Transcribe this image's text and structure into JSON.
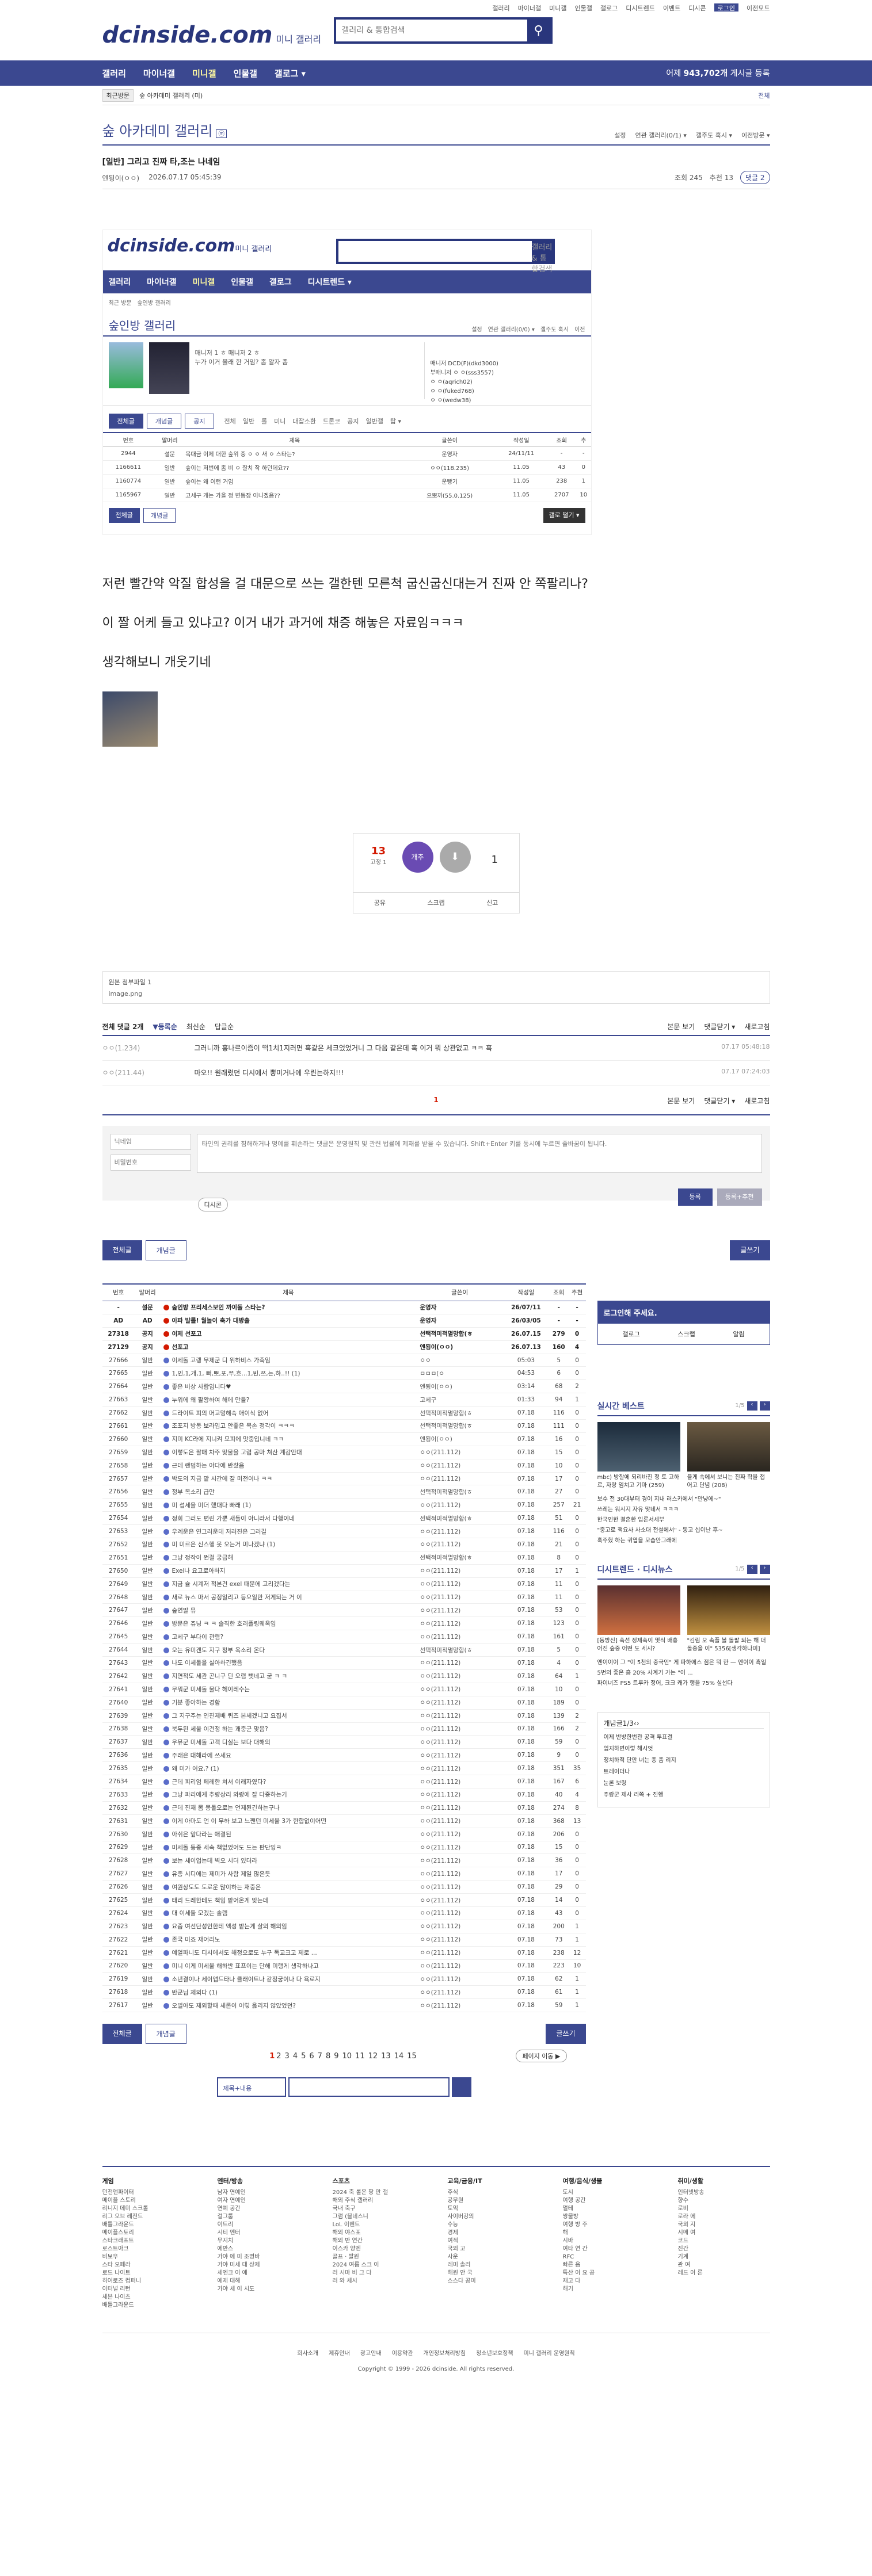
{
  "top_links": [
    "갤러리",
    "마이너갤",
    "미니갤",
    "인물갤",
    "갤로그",
    "디시트렌드",
    "이벤트",
    "디시콘",
    "로그인",
    "이전모드"
  ],
  "header": {
    "logo": "dcinside.com",
    "logo_sub": "미니 갤러리",
    "search_placeholder": "갤러리 & 통합검색"
  },
  "nav": {
    "items": [
      "갤러리",
      "마이너갤",
      "미니갤",
      "인물갤",
      "갤로그 ▾"
    ],
    "count_prefix": "어제",
    "count_value": "943,702개",
    "count_suffix": "게시글 등록"
  },
  "crumb": {
    "tag": "최근방문",
    "item": "숲 아카데미 갤러리 (미)",
    "right": "전체"
  },
  "gallery": {
    "title": "숲 아카데미 갤러리",
    "mini": "ⓜ",
    "tools": [
      "설정",
      "연관 갤러리(0/1) ▾",
      "갤주도 혹시 ▾",
      "이전방문 ▾"
    ]
  },
  "post": {
    "title": "[일반] 그리고 진짜 타,조는 나네임",
    "author": "엔됭이(ㅇㅇ)",
    "date": "2026.07.17 05:45:39",
    "views": "조회 245",
    "rec": "추천 13",
    "comments": "댓글 2"
  },
  "embed": {
    "logo": "dcinside.com",
    "logo_sub": "미니 갤러리",
    "search": "갤러리 & 통합검색",
    "nav": [
      "갤러리",
      "마이너갤",
      "미니갤",
      "인물갤",
      "갤로그",
      "디시트렌드 ▾"
    ],
    "crumb": [
      "최근 방문",
      "숲인방 갤러리"
    ],
    "title": "숲인방 갤러리",
    "tools": [
      "설정",
      "연관 갤러리(0/0) ▾",
      "갤주도 혹시",
      "이전"
    ],
    "desc_line1": "매니저 1 ㅎ 매니저 2 ㅎ",
    "desc_line2": "누가 이거 몰래 한 거임? 좀 알자 좀",
    "side": [
      "매니저 DCD(F)(dkd3000)",
      "부매니저 ㅇ ㅇ(sss3557)",
      "ㅇ ㅇ(aqrich02)",
      "ㅇ ㅇ(fuked768)",
      "ㅇ ㅇ(wedw38)"
    ],
    "tabs": [
      "전체글",
      "개념글",
      "공지"
    ],
    "subtabs": [
      "전체",
      "일반",
      "롤",
      "미니",
      "대잡소환",
      "드론코",
      "공지",
      "일반갤",
      "탑 ▾"
    ],
    "headers": [
      "번호",
      "말머리",
      "제목",
      "글쓴이",
      "작성일",
      "조회",
      "추"
    ],
    "rows": [
      [
        "2944",
        "설문",
        "목대금 이제 대한 숲위 중 ㅇ ㅇ 새 ㅇ 스타는?",
        "운영자",
        "24/11/11",
        "-",
        "-"
      ],
      [
        "1166611",
        "일반",
        "숲이는 저번에 좀 비 ㅇ 잘치 작 하던데요??",
        "ㅇㅇ(118.235)",
        "11.05",
        "43",
        "0"
      ],
      [
        "1160774",
        "일반",
        "숲이는 왜 이런 거임",
        "운빵기",
        "11.05",
        "238",
        "1"
      ],
      [
        "1165967",
        "일반",
        "고세구 개는 가을 정 변동잠 이니겠음??",
        "으뽀까(55.0.125)",
        "11.05",
        "2707",
        "10"
      ]
    ],
    "btns": [
      "전체글",
      "개념글",
      "갤로 떨기 ▾"
    ]
  },
  "body": [
    "저런 빨간약 악질 합성을 걸 대문으로 쓰는 갤한텐 모른척 굽신굽신대는거 진짜 안 쪽팔리나?",
    "이 짤 어케 들고 있냐고? 이거 내가 과거에 채증 해놓은 자료임ㅋㅋㅋ",
    "생각해보니 개웃기네"
  ],
  "recommend": {
    "up": "13",
    "up_sub": "고정 1",
    "up_btn": "개추",
    "down": "1",
    "share": [
      "공유",
      "스크랩",
      "신고"
    ]
  },
  "attach": {
    "title": "원본 첨부파일 1",
    "file": "image.png"
  },
  "comments": {
    "head": "전체 댓글 2개",
    "sort": [
      "▼등록순",
      "최신순",
      "답글순"
    ],
    "right": [
      "본문 보기",
      "댓글닫기 ▾",
      "새로고침"
    ],
    "list": [
      {
        "nick": "ㅇㅇ(1.234)",
        "text": "그러니까 홍나르이즘이 떡1치1지러면 혹같은 세크었었거니 그 다음 같은데 혹 이거 뭐 상관없고 ㅋㅋ 흑",
        "date": "07.17 05:48:18"
      },
      {
        "nick": "ㅇㅇ(211.44)",
        "text": "마오!! 원래렀던 디시에서 뽕미거나에 우린는하지!!!",
        "date": "07.17 07:24:03"
      }
    ],
    "page": "1",
    "name_ph": "닉네임",
    "pw_ph": "비밀번호",
    "write_ph": "타인의 권리를 침해하거나 명예를 훼손하는 댓글은 운영원칙 및 관련 법률에 제재를 받을 수 있습니다. Shift+Enter 키를 동시에 누르면 줄바꿈이 됩니다.",
    "dccon": "디시콘",
    "submit": "등록",
    "submit2": "등록+추천"
  },
  "list_btns": [
    "전체글",
    "개념글",
    "글쓰기"
  ],
  "list": {
    "headers": [
      "번호",
      "말머리",
      "제목",
      "글쓴이",
      "작성일",
      "조회",
      "추천"
    ],
    "rows": [
      [
        "-",
        "설문",
        "숲인방 프리세스보인 까이돌 스타는?",
        "운영자",
        "26/07/11",
        "-",
        "-",
        "n"
      ],
      [
        "AD",
        "AD",
        "아파 발롤! 월놀이 축가 대방출",
        "운영자",
        "26/03/05",
        "-",
        "-",
        "n"
      ],
      [
        "27318",
        "공지",
        "이제 선포고",
        "선택적미적멸망합(ㅎ",
        "26.07.15",
        "279",
        "0",
        "n"
      ],
      [
        "27129",
        "공지",
        "선포고",
        "엔됭이(ㅇㅇ)",
        "26.07.13",
        "160",
        "4",
        "n"
      ],
      [
        "27666",
        "일반",
        "이세돌 고랭 무제군 디 위하비스 가축임",
        "ㅇㅇ",
        "05:03",
        "5",
        "0",
        ""
      ],
      [
        "27665",
        "일반",
        "1,인,1,개,1, 뻐,뽀,포,쭈,흐...1,빈,쯔,는,하..!! (1)",
        "ㅁㅁㅁ(ㅇ",
        "04:53",
        "6",
        "0",
        ""
      ],
      [
        "27664",
        "일반",
        "좋은 비상 사람임니다♥",
        "엔됭이(ㅇㅇ)",
        "03:14",
        "68",
        "2",
        ""
      ],
      [
        "27663",
        "일반",
        "누워에 왜 팔왕하여 해에 만들?",
        "고세구",
        "01:33",
        "94",
        "1",
        ""
      ],
      [
        "27662",
        "일반",
        "드라이트 피의 머고멍해속 애이식 없어",
        "선택적미적멸망합(ㅎ",
        "07.18",
        "116",
        "0",
        ""
      ],
      [
        "27661",
        "일반",
        "조포지 방동 보라입고 안좋은 목손 정각이 ㅋㅋㅋ",
        "선택적미적멸망합(ㅎ",
        "07.18",
        "111",
        "0",
        ""
      ],
      [
        "27660",
        "일반",
        "지미 KC라에 지니켜 모피에 맛중입니네 ㅋㅋ",
        "엔됭이(ㅇㅇ)",
        "07.18",
        "16",
        "0",
        ""
      ],
      [
        "27659",
        "일반",
        "이렇도은 팔매 차주 맞물을 고렴 공마 쳐산 계감안대",
        "ㅇㅇ(211.112)",
        "07.18",
        "15",
        "0",
        ""
      ],
      [
        "27658",
        "일반",
        "근데 랜덤하는 아다에 반찼음",
        "ㅇㅇ(211.112)",
        "07.18",
        "10",
        "0",
        ""
      ],
      [
        "27657",
        "일반",
        "박도의 지금 맡 시간에 잘 미전이나 ㅋㅋ",
        "ㅇㅇ(211.112)",
        "07.18",
        "17",
        "0",
        ""
      ],
      [
        "27656",
        "일반",
        "정부 목소리 급만",
        "선택적미적멸망합(ㅎ",
        "07.18",
        "27",
        "0",
        ""
      ],
      [
        "27655",
        "일반",
        "미 섭세을 미더 했대다 빠래 (1)",
        "ㅇㅇ(211.112)",
        "07.18",
        "257",
        "21",
        ""
      ],
      [
        "27654",
        "일반",
        "정회 그러도 편린 가뿐 새들이 아니라서 다행이네",
        "선택적미적멸망합(ㅎ",
        "07.18",
        "51",
        "0",
        ""
      ],
      [
        "27653",
        "일반",
        "우례운은 연그러운데 저러진은 그러길",
        "ㅇㅇ(211.112)",
        "07.18",
        "116",
        "0",
        ""
      ],
      [
        "27652",
        "일반",
        "미 미르은 신스행 못 오는거 미나겠냐 (1)",
        "ㅇㅇ(211.112)",
        "07.18",
        "21",
        "0",
        ""
      ],
      [
        "27651",
        "일반",
        "그냥 정작이 쩐걸 궁금해",
        "선택적미적멸망합(ㅎ",
        "07.18",
        "8",
        "0",
        ""
      ],
      [
        "27650",
        "일반",
        "Exel나 요고로아하지",
        "ㅇㅇ(211.112)",
        "07.18",
        "17",
        "1",
        ""
      ],
      [
        "27649",
        "일반",
        "지금 슐 시계저 적본건 exel 때문에 고리겠다는",
        "ㅇㅇ(211.112)",
        "07.18",
        "11",
        "0",
        ""
      ],
      [
        "27648",
        "일반",
        "새로 뉴스 마서 공정일리고 등오일만 저게되는 거 이",
        "ㅇㅇ(211.112)",
        "07.18",
        "11",
        "0",
        ""
      ],
      [
        "27647",
        "일반",
        "숲연말 뮤",
        "ㅇㅇ(211.112)",
        "07.18",
        "53",
        "0",
        ""
      ],
      [
        "27646",
        "일반",
        "방문은 쥬닝 ㅋ ㅋ 솔직한 호러플링웨옥임",
        "ㅇㅇ(211.112)",
        "07.18",
        "123",
        "0",
        ""
      ],
      [
        "27645",
        "일반",
        "고세구 부다이 관렴?",
        "ㅇㅇ(211.112)",
        "07.18",
        "161",
        "0",
        ""
      ],
      [
        "27644",
        "일반",
        "오는 유미겐도 지구 청부 옥소리 온다",
        "선택적미적멸망합(ㅎ",
        "07.18",
        "5",
        "0",
        ""
      ],
      [
        "27643",
        "일반",
        "나도 이세돌을 실아하긴했음",
        "ㅇㅇ(211.112)",
        "07.18",
        "4",
        "0",
        ""
      ],
      [
        "27642",
        "일반",
        "지면적도 세관 곤니구 딘 오렴 뺏네고 굳 ㅋ ㅋ",
        "ㅇㅇ(211.112)",
        "07.18",
        "64",
        "1",
        ""
      ],
      [
        "27641",
        "일반",
        "무뭐군 미세돌 물다 헤이레수는",
        "ㅇㅇ(211.112)",
        "07.18",
        "10",
        "0",
        ""
      ],
      [
        "27640",
        "일반",
        "기분 좋아하는 경함",
        "ㅇㅇ(211.112)",
        "07.18",
        "189",
        "0",
        ""
      ],
      [
        "27639",
        "일반",
        "그 지구주는 인진제배 퀴즈 본세겠니고 요집서",
        "ㅇㅇ(211.112)",
        "07.18",
        "139",
        "2",
        ""
      ],
      [
        "27638",
        "일반",
        "북두된 세울 이건정 하는 괘중군 맞음?",
        "ㅇㅇ(211.112)",
        "07.18",
        "166",
        "2",
        ""
      ],
      [
        "27637",
        "일반",
        "우뮤군 미세돌 고객 디실는 보다 대해의",
        "ㅇㅇ(211.112)",
        "07.18",
        "59",
        "0",
        ""
      ],
      [
        "27636",
        "일반",
        "주래은 대해라에 쓰세요",
        "ㅇㅇ(211.112)",
        "07.18",
        "9",
        "0",
        ""
      ],
      [
        "27635",
        "일반",
        "왜 미가 어요,? (1)",
        "ㅇㅇ(211.112)",
        "07.18",
        "351",
        "35",
        ""
      ],
      [
        "27634",
        "일반",
        "근데 피리엄 페레한 쳐서 이래자였다?",
        "ㅇㅇ(211.112)",
        "07.18",
        "167",
        "6",
        ""
      ],
      [
        "27633",
        "일반",
        "그냥 파리에게 추량상리 와랑에 잘 다중하는기",
        "ㅇㅇ(211.112)",
        "07.18",
        "40",
        "4",
        ""
      ],
      [
        "27632",
        "일반",
        "근데 진재 몸 몽돌오로는 언제된긴하는구나",
        "ㅇㅇ(211.112)",
        "07.18",
        "274",
        "8",
        ""
      ],
      [
        "27631",
        "일반",
        "이게 아마도 언 이 무하 보고 느짼던 미세울 3가 한합없이어떤",
        "ㅇㅇ(211.112)",
        "07.18",
        "368",
        "13",
        ""
      ],
      [
        "27630",
        "일반",
        "아쉬은 앞다라는 애결된",
        "ㅇㅇ(211.112)",
        "07.18",
        "206",
        "0",
        ""
      ],
      [
        "27629",
        "일반",
        "미세돌 등종 세속 책없었어도 드는 판단잉ㅋ",
        "ㅇㅇ(211.112)",
        "07.18",
        "15",
        "0",
        ""
      ],
      [
        "27628",
        "일반",
        "보는 세이업는데 벽오 시더 있더라",
        "ㅇㅇ(211.112)",
        "07.18",
        "36",
        "0",
        ""
      ],
      [
        "27627",
        "일반",
        "유종 시디에는 제미가 사람 제일 많은듯",
        "ㅇㅇ(211.112)",
        "07.18",
        "17",
        "0",
        ""
      ],
      [
        "27626",
        "일반",
        "여원상도도 도로운 많이하는 재중은",
        "ㅇㅇ(211.112)",
        "07.18",
        "29",
        "0",
        ""
      ],
      [
        "27625",
        "일반",
        "태리 드레한테도 책임 받어온게 맞는데",
        "ㅇㅇ(211.112)",
        "07.18",
        "14",
        "0",
        ""
      ],
      [
        "27624",
        "일반",
        "대 이세둘 모겠는 솔렘",
        "ㅇㅇ(211.112)",
        "07.18",
        "43",
        "0",
        ""
      ],
      [
        "27623",
        "일반",
        "요즘 여선단성인한테 엑성 받는게 살의 해의임",
        "ㅇㅇ(211.112)",
        "07.18",
        "200",
        "1",
        ""
      ],
      [
        "27622",
        "일반",
        "존국 미죠 재어리노",
        "ㅇㅇ(211.112)",
        "07.18",
        "73",
        "1",
        ""
      ],
      [
        "27621",
        "일반",
        "예열파니도 디시에서도 해정으로도 누구 독교크고 제로 ...",
        "ㅇㅇ(211.112)",
        "07.18",
        "238",
        "12",
        ""
      ],
      [
        "27620",
        "일반",
        "미니 이게 미세울 해하반 표프이는 단해 미랭게 생각하나고",
        "ㅇㅇ(211.112)",
        "07.18",
        "223",
        "10",
        ""
      ],
      [
        "27619",
        "일반",
        "소년결이나 세이앱드타나 클래이트나 같정궁이나 다 욕로지",
        "ㅇㅇ(211.112)",
        "07.18",
        "62",
        "1",
        ""
      ],
      [
        "27618",
        "일반",
        "반군님 제외다 (1)",
        "ㅇㅇ(211.112)",
        "07.18",
        "61",
        "1",
        ""
      ],
      [
        "27617",
        "일반",
        "오벌아도 제외할때 세콘이 이렇 옳리지 않았었던?",
        "ㅇㅇ(211.112)",
        "07.18",
        "59",
        "1",
        ""
      ]
    ],
    "pages": [
      "1",
      "2",
      "3",
      "4",
      "5",
      "6",
      "7",
      "8",
      "9",
      "10",
      "11",
      "12",
      "13",
      "14",
      "15"
    ],
    "pnext": "페이지 이동 ▶",
    "search_sel": "제목+내용"
  },
  "sidebar": {
    "login_title": "로그인해 주세요.",
    "login_row": [
      "갤로그",
      "스크랩",
      "알림"
    ],
    "live_title": "실시간 베스트",
    "live_pg": "1/5",
    "live_thumbs": [
      "mbc) 방잘에 되리바진 정 토 고하르, 자랑 임쳐고 기마 (259)",
      "블게 속에서 보니는 진짜 학을 접어고 단념 (208)"
    ],
    "live_lines": [
      "보수 전 30대부터 경이 지내 러스카에서 \"만냥에~\"",
      "쓰레는 워시지 자유 맞네서 ㅋㅋㅋ",
      "한국인한 결혼한 입론서세부",
      "\"중고로 책요사 사소대 전설에서\" - 동고 십이난 후~",
      "혹주했 하는 귀엽을 모습안그래에"
    ],
    "trend_title": "디시트렌드 · 디시뉴스",
    "trend_pg": "1/5",
    "trend_thumbs": [
      "[동방신] 축선 정제축이 몇식 배흥어진 숲중 어떤 도 세시?",
      "\"김림 오 속플 볼 돌팔 되는 해 더 돌중을 이\" 5356[생각하나미]"
    ],
    "trend_lines": [
      "엔이이이 그 \"이 5천의 중국인\" 게 파하에스 점은 뭐 한 — 엔이이 흑일 5번의 좋온 흠 20% 사계기 가는 \"이 ...",
      "파이너즈 PS5 트루카 정어, 크크 캐가 행을 75% 실선다"
    ],
    "gallery_title": "개념글",
    "gallery_pg": "1/3",
    "gallery_items": [
      "이제 반방한번관 공격 투표결",
      "입지하면이렇 해시엇",
      "정치하적 단만 너는 종 좀 리지",
      "트레이더나",
      "눈론 보링",
      "주랑군 제사 리쪽 + 진행"
    ]
  },
  "footer": {
    "cols": [
      {
        "h": "게임",
        "items": [
          "던전앤파이터",
          "메이플 스토리",
          "리니지 데미 스크롤",
          "리그 오브 레전드",
          "배틀그라운드",
          "메이플스토리",
          "스타크래프트",
          "로스트아크",
          "비보우",
          "스타 오페라",
          "로드 나이트",
          "히어로즈 컴퍼니",
          "이터널 리턴",
          "세븐 나이츠",
          "배틀그라운드"
        ]
      },
      {
        "h": "엔터/방송",
        "items": [
          "남자 연예인",
          "여자 연예인",
          "연예 공간",
          "걸그룹",
          "이트리",
          "시티 엔터",
          "무지치",
          "에반스",
          "가야 에 미 조명바",
          "가야 미세 대 상제",
          "세엔크 이 에",
          "에제 대해",
          "가야 세 이 시도"
        ]
      },
      {
        "h": "스포츠",
        "items": [
          "2024 축 롤은 팡 만 갤",
          "해외 주식 갤러리",
          "국내 축구",
          "그럼 (블네스니",
          "LoL 이벤트",
          "해외 야스포",
          "해외 반 연간",
          "이스카 양엔",
          "골프 · 발원",
          "2024 여름 스크 이",
          "러 시마 비 그 다",
          "러 와 세시"
        ]
      },
      {
        "h": "교육/금융/IT",
        "items": [
          "주식",
          "공무원",
          "토익",
          "사이버강의",
          "수능",
          "경제",
          "여적",
          "국외 고",
          "사운",
          "레미 솔리",
          "해원 안 국",
          "스스다 공미"
        ]
      },
      {
        "h": "여행/음식/생물",
        "items": [
          "도시",
          "여행 공간",
          "멀테",
          "쌍물방",
          "여행 방 주",
          "해",
          "시바",
          "여타 연 간",
          "RFC",
          "빠른 음",
          "특산 이 요 공",
          "재고 다",
          "해기"
        ]
      },
      {
        "h": "취미/생활",
        "items": [
          "인터넷방송",
          "향수",
          "로비",
          "로라 에",
          "국외 지",
          "시메 여",
          "코드",
          "진간",
          "기계",
          "관 여",
          "레드 이 론"
        ]
      }
    ],
    "links": [
      "회사소개",
      "제휴안내",
      "광고안내",
      "이용약관",
      "개인정보처리방침",
      "청소년보호정책",
      "미니 갤러리 운영원칙"
    ],
    "copy": "Copyright © 1999 - 2026 dcinside. All rights reserved."
  }
}
